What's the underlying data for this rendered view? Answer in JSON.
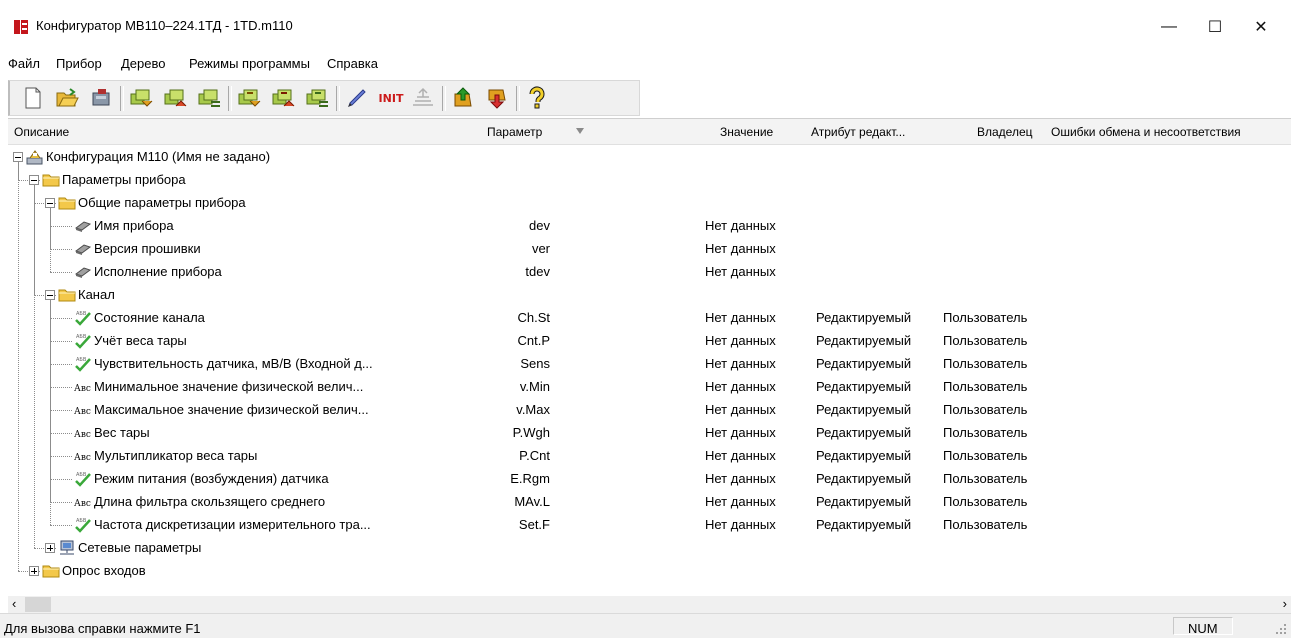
{
  "window": {
    "title": "Конфигуратор МВ110–224.1ТД - 1TD.m110",
    "minimize": "—",
    "maximize": "☐",
    "close": "✕"
  },
  "menu": [
    "Файл",
    "Прибор",
    "Дерево",
    "Режимы программы",
    "Справка"
  ],
  "toolbar": {
    "buttons": [
      "new-file-icon",
      "open-folder-icon",
      "device-icon",
      "read-params-icon",
      "write-params-icon",
      "compare-params-icon",
      "read-all-icon",
      "write-all-icon",
      "compare-all-icon",
      "pen-icon",
      "init-icon",
      "disabled-tool-icon",
      "upload-firmware-icon",
      "download-firmware-icon",
      "help-icon"
    ],
    "init_label": "INIT"
  },
  "columns": {
    "description": "Описание",
    "parameter": "Параметр",
    "value": "Значение",
    "attribute": "Атрибут редакт...",
    "owner": "Владелец",
    "errors": "Ошибки обмена и несоответствия"
  },
  "tree": [
    {
      "label": "Конфигурация М110 (Имя не задано)",
      "icon": "config-icon",
      "param": "",
      "value": "",
      "attr": "",
      "owner": ""
    },
    {
      "label": "Параметры прибора",
      "icon": "folder-icon",
      "param": "",
      "value": "",
      "attr": "",
      "owner": ""
    },
    {
      "label": "Общие параметры прибора",
      "icon": "folder-icon",
      "param": "",
      "value": "",
      "attr": "",
      "owner": ""
    },
    {
      "label": "Имя прибора",
      "icon": "readonly-param-icon",
      "param": "dev",
      "value": "Нет данных",
      "attr": "",
      "owner": ""
    },
    {
      "label": "Версия прошивки",
      "icon": "readonly-param-icon",
      "param": "ver",
      "value": "Нет данных",
      "attr": "",
      "owner": ""
    },
    {
      "label": "Исполнение прибора",
      "icon": "readonly-param-icon",
      "param": "tdev",
      "value": "Нет данных",
      "attr": "",
      "owner": ""
    },
    {
      "label": "Канал",
      "icon": "folder-icon",
      "param": "",
      "value": "",
      "attr": "",
      "owner": ""
    },
    {
      "label": "Состояние канала",
      "icon": "enum-param-icon",
      "param": "Ch.St",
      "value": "Нет данных",
      "attr": "Редактируемый",
      "owner": "Пользователь"
    },
    {
      "label": "Учёт веса тары",
      "icon": "enum-param-icon",
      "param": "Cnt.P",
      "value": "Нет данных",
      "attr": "Редактируемый",
      "owner": "Пользователь"
    },
    {
      "label": "Чувствительность датчика, мВ/В (Входной д...",
      "icon": "enum-param-icon",
      "param": "Sens",
      "value": "Нет данных",
      "attr": "Редактируемый",
      "owner": "Пользователь"
    },
    {
      "label": "Минимальное значение физической велич...",
      "icon": "text-param-icon",
      "param": "v.Min",
      "value": "Нет данных",
      "attr": "Редактируемый",
      "owner": "Пользователь"
    },
    {
      "label": "Максимальное значение физической велич...",
      "icon": "text-param-icon",
      "param": "v.Max",
      "value": "Нет данных",
      "attr": "Редактируемый",
      "owner": "Пользователь"
    },
    {
      "label": "Вес тары",
      "icon": "text-param-icon",
      "param": "P.Wgh",
      "value": "Нет данных",
      "attr": "Редактируемый",
      "owner": "Пользователь"
    },
    {
      "label": "Мультипликатор веса тары",
      "icon": "text-param-icon",
      "param": "P.Cnt",
      "value": "Нет данных",
      "attr": "Редактируемый",
      "owner": "Пользователь"
    },
    {
      "label": "Режим питания (возбуждения) датчика",
      "icon": "enum-param-icon",
      "param": "E.Rgm",
      "value": "Нет данных",
      "attr": "Редактируемый",
      "owner": "Пользователь"
    },
    {
      "label": "Длина фильтра скользящего среднего",
      "icon": "text-param-icon",
      "param": "MAv.L",
      "value": "Нет данных",
      "attr": "Редактируемый",
      "owner": "Пользователь"
    },
    {
      "label": "Частота дискретизации измерительного тра...",
      "icon": "enum-param-icon",
      "param": "Set.F",
      "value": "Нет данных",
      "attr": "Редактируемый",
      "owner": "Пользователь"
    },
    {
      "label": "Сетевые параметры",
      "icon": "network-icon",
      "param": "",
      "value": "",
      "attr": "",
      "owner": ""
    },
    {
      "label": "Опрос входов",
      "icon": "folder-icon",
      "param": "",
      "value": "",
      "attr": "",
      "owner": ""
    }
  ],
  "icon_text": {
    "abc": "Авс",
    "enum": "АБВ"
  },
  "status": {
    "help": "Для вызова справки нажмите F1",
    "num": "NUM"
  }
}
